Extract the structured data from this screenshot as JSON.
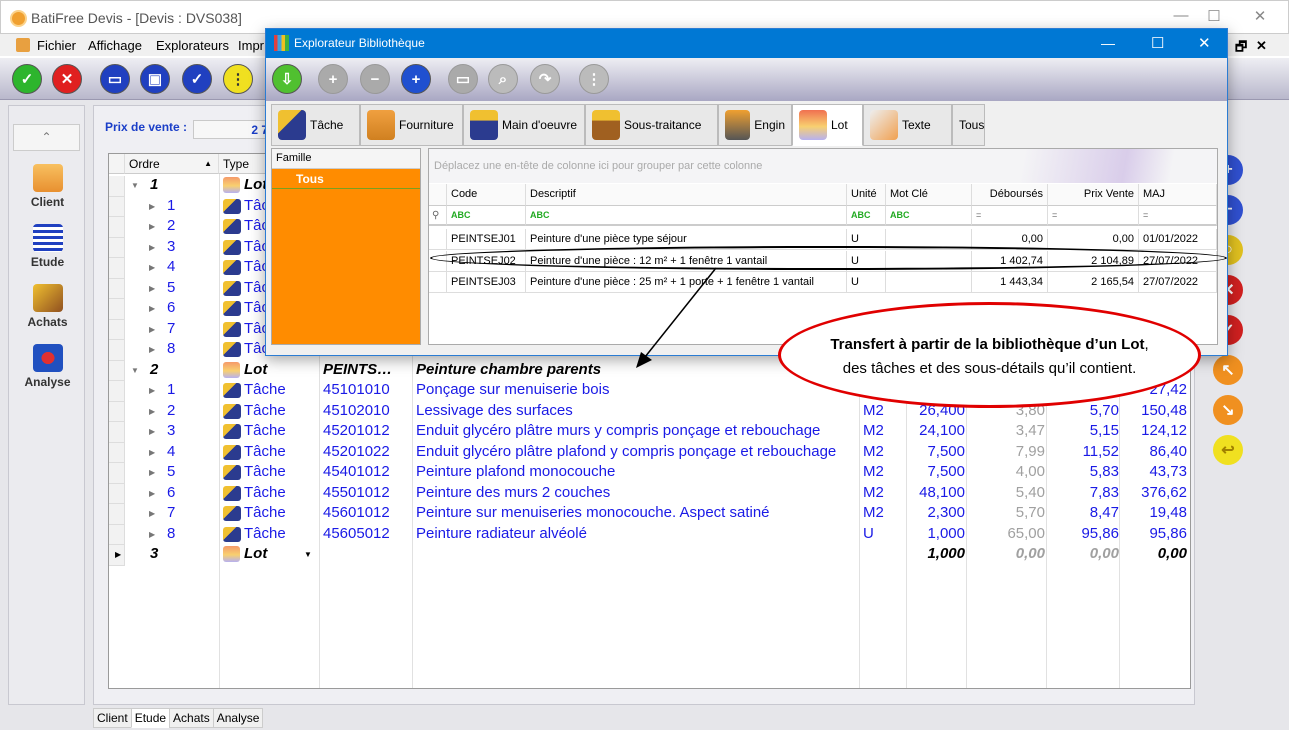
{
  "window": {
    "title": "BatiFree Devis - [Devis : DVS038]",
    "minimize": "—",
    "maximize": "☐",
    "close": "✕",
    "mdi_restore": "🗗",
    "mdi_close": "✕"
  },
  "menu": [
    "Fichier",
    "Affichage",
    "Explorateurs",
    "Impr"
  ],
  "sidebar": {
    "items": [
      {
        "label": "Client"
      },
      {
        "label": "Etude"
      },
      {
        "label": "Achats"
      },
      {
        "label": "Analyse"
      }
    ]
  },
  "summary": {
    "prix_label": "Prix de vente :",
    "prix_value": "2 7"
  },
  "grid": {
    "headers": {
      "ordre": "Ordre",
      "type": "Type"
    },
    "rows": [
      {
        "lvl": 0,
        "ordre": "1",
        "type": "Lot",
        "code": "",
        "desc": "",
        "unit": "",
        "qty": "",
        "deb": "",
        "pu": "",
        "total": ""
      },
      {
        "lvl": 1,
        "ordre": "1",
        "type": "Tâche"
      },
      {
        "lvl": 1,
        "ordre": "2",
        "type": "Tâche"
      },
      {
        "lvl": 1,
        "ordre": "3",
        "type": "Tâche"
      },
      {
        "lvl": 1,
        "ordre": "4",
        "type": "Tâche"
      },
      {
        "lvl": 1,
        "ordre": "5",
        "type": "Tâche"
      },
      {
        "lvl": 1,
        "ordre": "6",
        "type": "Tâche"
      },
      {
        "lvl": 1,
        "ordre": "7",
        "type": "Tâche"
      },
      {
        "lvl": 1,
        "ordre": "8",
        "type": "Tâche"
      },
      {
        "lvl": 0,
        "ordre": "2",
        "type": "Lot",
        "code": "PEINTS…",
        "desc": "Peinture chambre parents"
      },
      {
        "lvl": 1,
        "ordre": "1",
        "type": "Tâche",
        "code": "45101010",
        "desc": "Ponçage sur menuiserie bois",
        "total": "27,42"
      },
      {
        "lvl": 1,
        "ordre": "2",
        "type": "Tâche",
        "code": "45102010",
        "desc": "Lessivage des surfaces",
        "unit": "M2",
        "qty": "26,400",
        "deb": "3,80",
        "pu": "5,70",
        "total": "150,48"
      },
      {
        "lvl": 1,
        "ordre": "3",
        "type": "Tâche",
        "code": "45201012",
        "desc": "Enduit glycéro plâtre murs y compris ponçage et rebouchage",
        "unit": "M2",
        "qty": "24,100",
        "deb": "3,47",
        "pu": "5,15",
        "total": "124,12"
      },
      {
        "lvl": 1,
        "ordre": "4",
        "type": "Tâche",
        "code": "45201022",
        "desc": "Enduit glycéro plâtre plafond y compris ponçage et rebouchage",
        "unit": "M2",
        "qty": "7,500",
        "deb": "7,99",
        "pu": "11,52",
        "total": "86,40"
      },
      {
        "lvl": 1,
        "ordre": "5",
        "type": "Tâche",
        "code": "45401012",
        "desc": "Peinture plafond monocouche",
        "unit": "M2",
        "qty": "7,500",
        "deb": "4,00",
        "pu": "5,83",
        "total": "43,73"
      },
      {
        "lvl": 1,
        "ordre": "6",
        "type": "Tâche",
        "code": "45501012",
        "desc": "Peinture des murs 2 couches",
        "unit": "M2",
        "qty": "48,100",
        "deb": "5,40",
        "pu": "7,83",
        "total": "376,62"
      },
      {
        "lvl": 1,
        "ordre": "7",
        "type": "Tâche",
        "code": "45601012",
        "desc": "Peinture sur menuiseries monocouche. Aspect satiné",
        "unit": "M2",
        "qty": "2,300",
        "deb": "5,70",
        "pu": "8,47",
        "total": "19,48"
      },
      {
        "lvl": 1,
        "ordre": "8",
        "type": "Tâche",
        "code": "45605012",
        "desc": "Peinture radiateur alvéolé",
        "unit": "U",
        "qty": "1,000",
        "deb": "65,00",
        "pu": "95,86",
        "total": "95,86"
      },
      {
        "lvl": 0,
        "ordre": "3",
        "type": "Lot",
        "qty": "1,000",
        "deb": "0,00",
        "pu": "0,00",
        "total": "0,00",
        "current": true
      }
    ]
  },
  "bottom_tabs": [
    "Client",
    "Etude",
    "Achats",
    "Analyse"
  ],
  "bottom_tab_active": "Etude",
  "dialog": {
    "title": "Explorateur Bibliothèque",
    "tabs": [
      {
        "label": "Tâche"
      },
      {
        "label": "Fourniture"
      },
      {
        "label": "Main d'oeuvre"
      },
      {
        "label": "Sous-traitance"
      },
      {
        "label": "Engin"
      },
      {
        "label": "Lot",
        "active": true
      },
      {
        "label": "Texte"
      },
      {
        "label": "Tous"
      }
    ],
    "famille": {
      "header": "Famille",
      "selected": "Tous"
    },
    "group_hint": "Déplacez une en-tête de colonne ici pour grouper par cette colonne",
    "columns": [
      "Code",
      "Descriptif",
      "Unité",
      "Mot Clé",
      "Déboursés",
      "Prix Vente",
      "MAJ"
    ],
    "filters": [
      "ABC",
      "ABC",
      "ABC",
      "ABC",
      "=",
      "=",
      "="
    ],
    "rows": [
      {
        "code": "PEINTSEJ01",
        "desc": "Peinture d'une pièce type séjour",
        "unit": "U",
        "mot": "",
        "deb": "0,00",
        "pv": "0,00",
        "maj": "01/01/2022"
      },
      {
        "code": "PEINTSEJ02",
        "desc": "Peinture d'une pièce : 12 m² + 1 fenêtre 1 vantail",
        "unit": "U",
        "mot": "",
        "deb": "1 402,74",
        "pv": "2 104,89",
        "maj": "27/07/2022"
      },
      {
        "code": "PEINTSEJ03",
        "desc": "Peinture d'une pièce : 25 m² + 1 porte + 1 fenêtre 1 vantail",
        "unit": "U",
        "mot": "",
        "deb": "1 443,34",
        "pv": "2 165,54",
        "maj": "27/07/2022"
      }
    ]
  },
  "callout": {
    "bold": "Transfert à partir de la bibliothèque d’un Lot",
    "rest": "des tâches et des sous-détails qu’il contient."
  },
  "colors": {
    "dialog_title": "#0078d4",
    "famille": "#ff8c00",
    "grid_text": "#1a1ae6",
    "callout_border": "#e00000"
  }
}
